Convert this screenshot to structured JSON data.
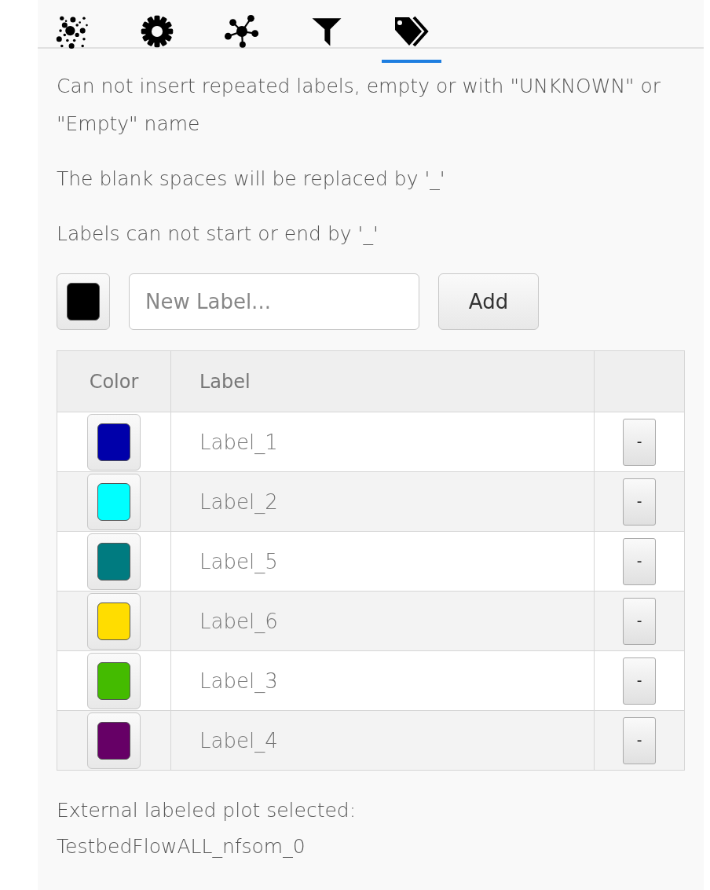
{
  "tabs": [
    {
      "kind": "bubbles",
      "selected": false
    },
    {
      "kind": "gear",
      "selected": false
    },
    {
      "kind": "network",
      "selected": false
    },
    {
      "kind": "filter",
      "selected": false
    },
    {
      "kind": "tags",
      "selected": true
    }
  ],
  "notes": [
    "Can not insert repeated labels, empty or with \"UNKNOWN\" or \"Empty\" name",
    "The blank spaces will be replaced by '_'",
    "Labels can not start or end by '_'"
  ],
  "new_label": {
    "color": "#000000",
    "placeholder": "New Label...",
    "button": "Add"
  },
  "table": {
    "columns": [
      "Color",
      "Label"
    ],
    "rows": [
      {
        "color": "#0000aa",
        "label": "Label_1",
        "button": "-"
      },
      {
        "color": "#00ffff",
        "label": "Label_2",
        "button": "-"
      },
      {
        "color": "#007b80",
        "label": "Label_5",
        "button": "-"
      },
      {
        "color": "#ffdd00",
        "label": "Label_6",
        "button": "-"
      },
      {
        "color": "#44bb00",
        "label": "Label_3",
        "button": "-"
      },
      {
        "color": "#660066",
        "label": "Label_4",
        "button": "-"
      }
    ]
  },
  "footer": [
    "External labeled plot selected:",
    "TestbedFlowALL_nfsom_0"
  ]
}
